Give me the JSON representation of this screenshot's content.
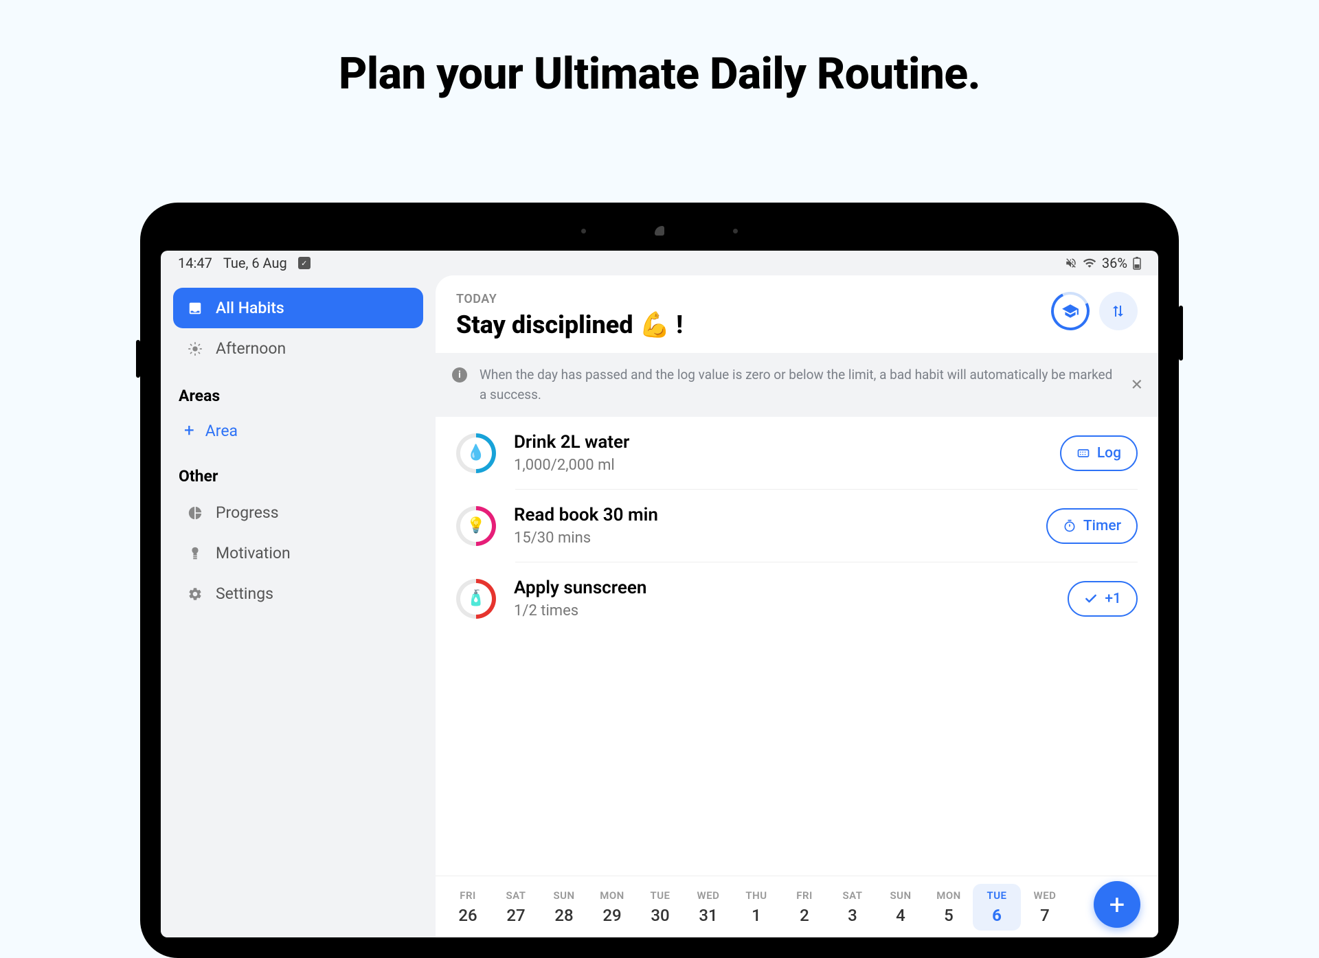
{
  "hero": {
    "title": "Plan your Ultimate Daily Routine."
  },
  "statusbar": {
    "time": "14:47",
    "date": "Tue, 6 Aug",
    "battery": "36%"
  },
  "sidebar": {
    "nav": [
      {
        "label": "All Habits",
        "active": true
      },
      {
        "label": "Afternoon",
        "active": false
      }
    ],
    "areas_label": "Areas",
    "add_area_label": "Area",
    "other_label": "Other",
    "other": [
      {
        "label": "Progress"
      },
      {
        "label": "Motivation"
      },
      {
        "label": "Settings"
      }
    ]
  },
  "main": {
    "today_label": "TODAY",
    "tagline": "Stay disciplined 💪 !",
    "info_text": "When the day has passed and the log value is zero or below the limit, a bad habit will automatically be marked a success.",
    "habits": [
      {
        "title": "Drink 2L water",
        "sub": "1,000/2,000 ml",
        "btn": "Log",
        "color": "#17a2d8",
        "icon": "💧",
        "progress": 0.5
      },
      {
        "title": "Read book 30 min",
        "sub": "15/30 mins",
        "btn": "Timer",
        "color": "#e61e78",
        "icon": "💡",
        "progress": 0.5
      },
      {
        "title": "Apply sunscreen",
        "sub": "1/2 times",
        "btn": "+1",
        "color": "#e6342e",
        "icon": "🧴",
        "progress": 0.5
      }
    ]
  },
  "calendar": {
    "days": [
      {
        "dow": "FRI",
        "num": "26"
      },
      {
        "dow": "SAT",
        "num": "27"
      },
      {
        "dow": "SUN",
        "num": "28"
      },
      {
        "dow": "MON",
        "num": "29"
      },
      {
        "dow": "TUE",
        "num": "30"
      },
      {
        "dow": "WED",
        "num": "31"
      },
      {
        "dow": "THU",
        "num": "1"
      },
      {
        "dow": "FRI",
        "num": "2"
      },
      {
        "dow": "SAT",
        "num": "3"
      },
      {
        "dow": "SUN",
        "num": "4"
      },
      {
        "dow": "MON",
        "num": "5"
      },
      {
        "dow": "TUE",
        "num": "6",
        "selected": true
      },
      {
        "dow": "WED",
        "num": "7"
      }
    ]
  }
}
